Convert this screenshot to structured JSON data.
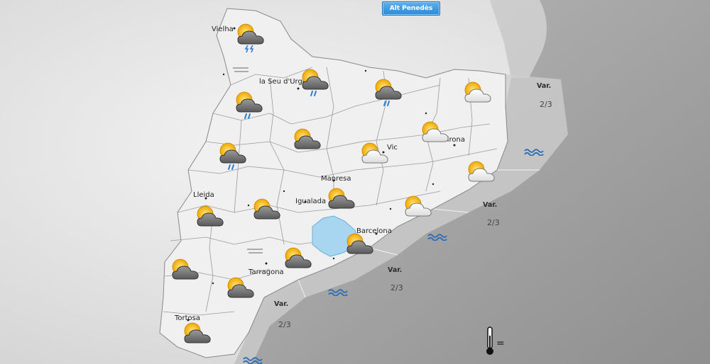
{
  "region_button": {
    "label": "Alt Penedès"
  },
  "cities": [
    {
      "name": "Vielha"
    },
    {
      "name": "la Seu d'Urgell"
    },
    {
      "name": "Vic"
    },
    {
      "name": "Girona"
    },
    {
      "name": "Manresa"
    },
    {
      "name": "Lleida"
    },
    {
      "name": "Igualada"
    },
    {
      "name": "Barcelona"
    },
    {
      "name": "Tarragona"
    },
    {
      "name": "Tortosa"
    }
  ],
  "sea_zones": [
    {
      "label": "Var.",
      "value": "2/3"
    },
    {
      "label": "Var.",
      "value": "2/3"
    },
    {
      "label": "Var.",
      "value": "2/3"
    },
    {
      "label": "Var.",
      "value": "2/3"
    }
  ],
  "weather_icons": [
    "cloud-sun-thunder-icon",
    "cloud-sun-rain-icon",
    "cloud-sun-rain-icon",
    "cloud-sun-rain-icon",
    "cloud-sun-icon",
    "cloud-sun-rain-icon",
    "cloud-sun-icon",
    "cloud-sun-icon",
    "cloud-sun-icon",
    "cloud-sun-icon",
    "cloud-sun-icon",
    "cloud-sun-icon",
    "cloud-sun-icon",
    "cloud-sun-icon",
    "cloud-sun-icon",
    "cloud-sun-icon",
    "cloud-sun-icon",
    "cloud-sun-icon",
    "cloud-sun-icon"
  ],
  "legend": {
    "thermometer_symbol": "="
  },
  "colors": {
    "highlight_region": "#a8d6f0",
    "waves": "#2f6db5",
    "sea": "#a3a3a3",
    "land": "#ececec"
  }
}
